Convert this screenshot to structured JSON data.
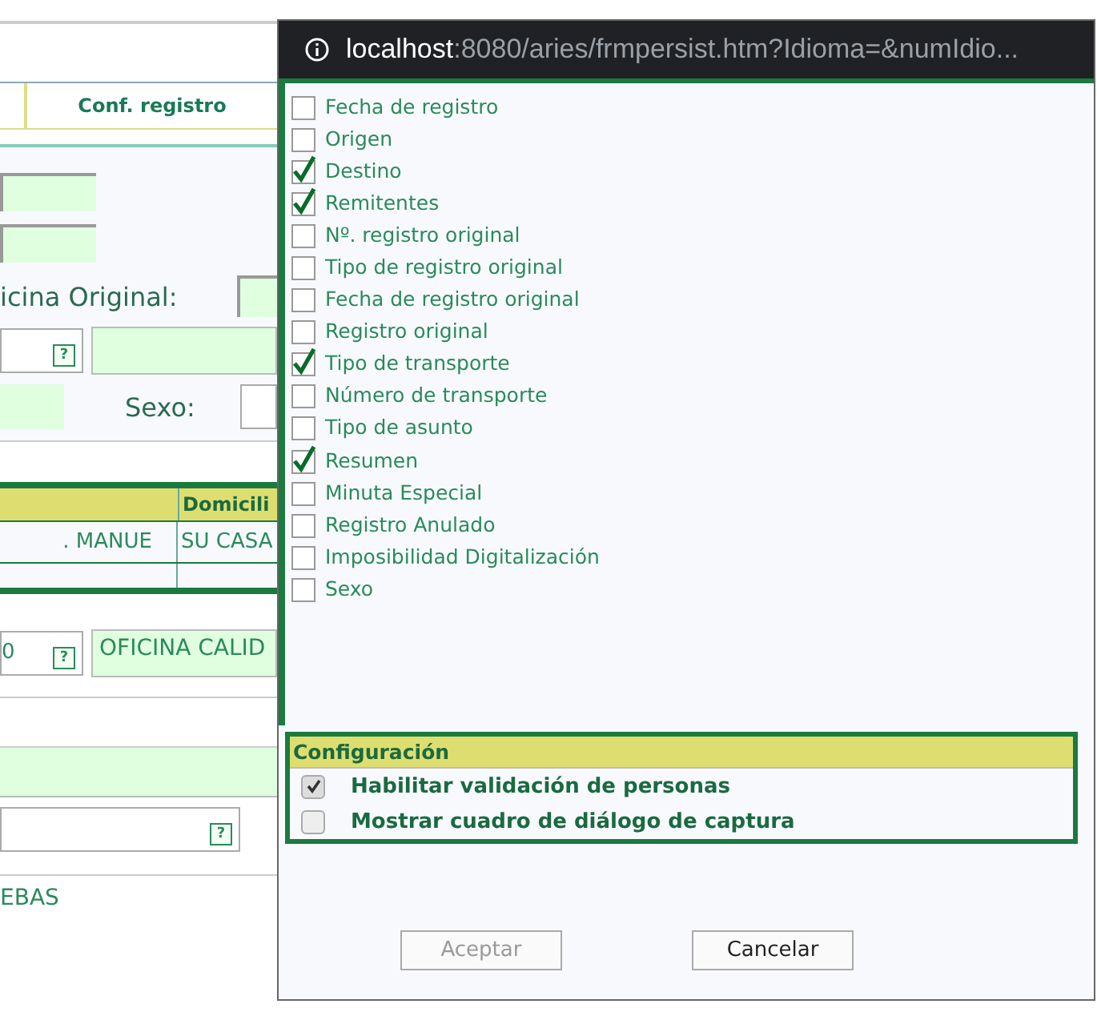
{
  "background": {
    "tab": "Conf. registro",
    "label_office": "icina Original:",
    "label_sex": "Sexo:",
    "table": {
      "header": "Domicili",
      "rows": [
        {
          "cells": [
            ". MANUE",
            "SU CASA"
          ]
        }
      ]
    },
    "help_icons": [
      "?",
      "?",
      "?"
    ],
    "office_code": "0",
    "office_name": "OFICINA CALID",
    "footer_text": "EBAS"
  },
  "popup": {
    "url_host": "localhost",
    "url_rest": ":8080/aries/frmpersist.htm?Idioma=&numIdio...",
    "fields": [
      {
        "label": "Fecha de registro",
        "checked": false
      },
      {
        "label": "Origen",
        "checked": false
      },
      {
        "label": "Destino",
        "checked": true
      },
      {
        "label": "Remitentes",
        "checked": true
      },
      {
        "label": "Nº. registro original",
        "checked": false
      },
      {
        "label": "Tipo de registro original",
        "checked": false
      },
      {
        "label": "Fecha de registro original",
        "checked": false
      },
      {
        "label": "Registro original",
        "checked": false
      },
      {
        "label": "Tipo de transporte",
        "checked": true
      },
      {
        "label": "Número de transporte",
        "checked": false
      },
      {
        "label": "Tipo de asunto",
        "checked": false
      },
      {
        "label": "Resumen",
        "checked": true
      },
      {
        "label": "Minuta Especial",
        "checked": false
      },
      {
        "label": "Registro Anulado",
        "checked": false
      },
      {
        "label": "Imposibilidad Digitalización",
        "checked": false
      },
      {
        "label": "Sexo",
        "checked": false
      }
    ],
    "config": {
      "title": "Configuración",
      "options": [
        {
          "label": "Habilitar validación de personas",
          "checked": true
        },
        {
          "label": "Mostrar cuadro de diálogo de captura",
          "checked": false
        }
      ]
    },
    "buttons": [
      {
        "label": "Aceptar",
        "disabled": true
      },
      {
        "label": "Cancelar",
        "disabled": false
      }
    ]
  }
}
